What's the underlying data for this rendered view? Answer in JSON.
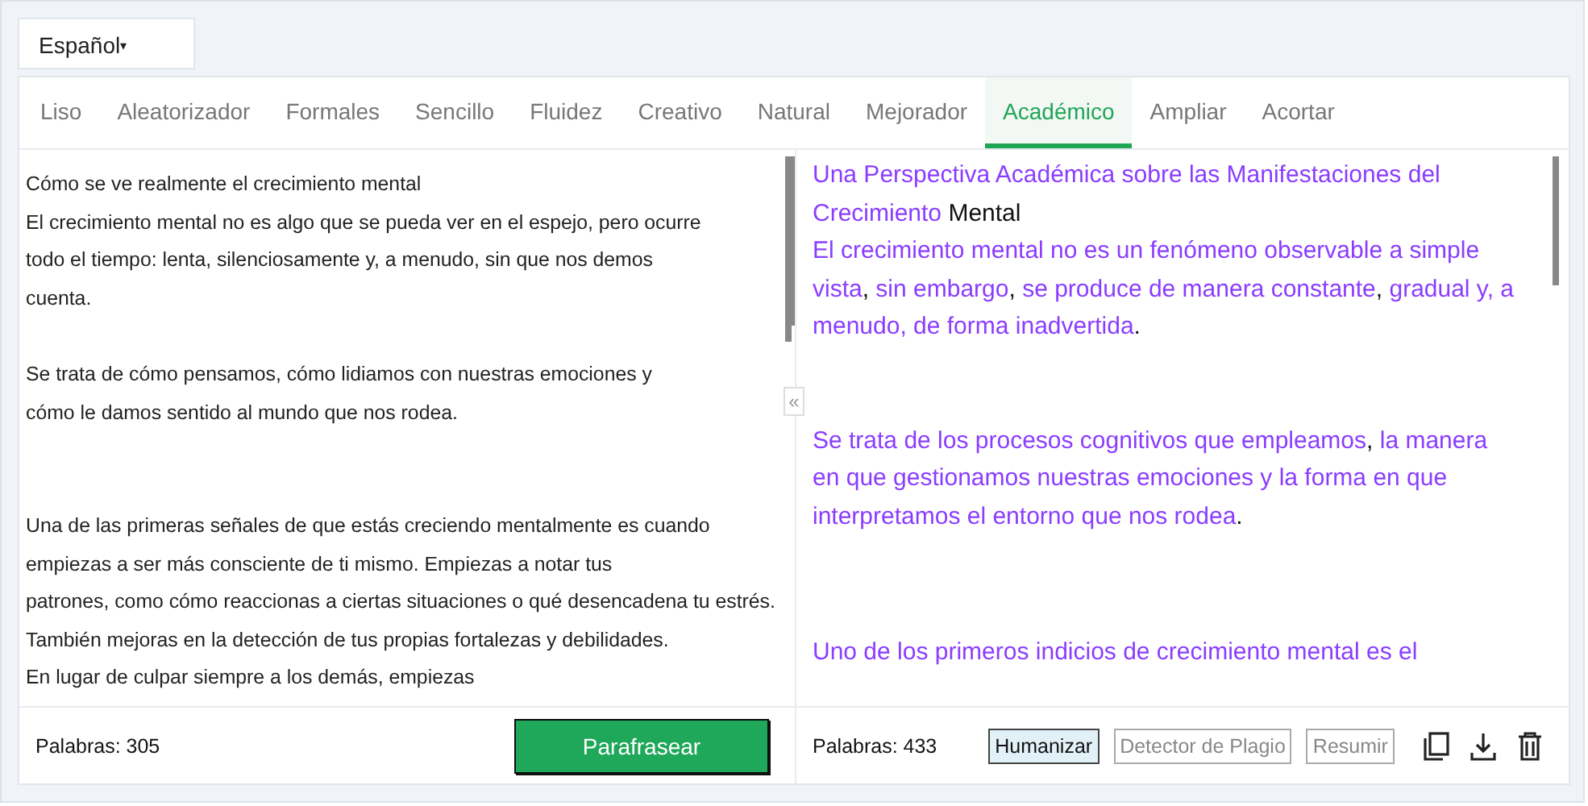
{
  "language_selector": {
    "value": "Español",
    "caret": "▾"
  },
  "tabs": [
    {
      "label": "Liso",
      "selected": false
    },
    {
      "label": "Aleatorizador",
      "selected": false
    },
    {
      "label": "Formales",
      "selected": false
    },
    {
      "label": "Sencillo",
      "selected": false
    },
    {
      "label": "Fluidez",
      "selected": false
    },
    {
      "label": "Creativo",
      "selected": false
    },
    {
      "label": "Natural",
      "selected": false
    },
    {
      "label": "Mejorador",
      "selected": false
    },
    {
      "label": "Académico",
      "selected": true
    },
    {
      "label": "Ampliar",
      "selected": false
    },
    {
      "label": "Acortar",
      "selected": false
    }
  ],
  "input": {
    "paragraphs": [
      [
        "Cómo se ve realmente el crecimiento mental",
        "El crecimiento mental no es algo que se pueda ver en el espejo, pero ocurre",
        "todo el tiempo: lenta, silenciosamente y, a menudo, sin que nos demos",
        "cuenta."
      ],
      [
        "Se trata de cómo pensamos, cómo lidiamos con nuestras emociones y",
        "cómo le damos sentido al mundo que nos rodea."
      ],
      [
        "Una de las primeras señales de que estás creciendo mentalmente es cuando",
        "empiezas a ser más consciente de ti mismo. Empiezas a notar tus",
        "patrones, como cómo reaccionas a ciertas situaciones o qué desencadena tu estrés.",
        "También mejoras en la detección de tus propias fortalezas y debilidades.",
        "En lugar de culpar siempre a los demás, empiezas"
      ]
    ],
    "word_count": "Palabras: 305",
    "action_button": "Parafrasear"
  },
  "collapse_button": "«",
  "output": {
    "paragraphs": [
      [
        {
          "text": "Una Perspectiva Académica sobre las Manifestaciones del Crecimiento",
          "changed": true
        },
        {
          "text": " Mental",
          "changed": false
        }
      ],
      [
        {
          "text": "El crecimiento mental no es un fenómeno observable a simple vista",
          "changed": true
        },
        {
          "text": ",",
          "changed": false
        },
        {
          "text": " sin embargo",
          "changed": true
        },
        {
          "text": ",",
          "changed": false
        },
        {
          "text": " se produce de manera constante",
          "changed": true
        },
        {
          "text": ",",
          "changed": false
        },
        {
          "text": " gradual y, a menudo, de forma inadvertida",
          "changed": true
        },
        {
          "text": ".",
          "changed": false
        }
      ],
      [
        {
          "text": "Se trata de los procesos cognitivos que empleamos",
          "changed": true
        },
        {
          "text": ",",
          "changed": false
        },
        {
          "text": " la manera en que gestionamos nuestras emociones y la forma en que interpretamos el entorno que nos rodea",
          "changed": true
        },
        {
          "text": ".",
          "changed": false
        }
      ],
      [
        {
          "text": "Uno de los primeros indicios de crecimiento mental es el",
          "changed": true
        }
      ]
    ],
    "word_count": "Palabras: 433",
    "tools": [
      {
        "label": "Humanizar",
        "selected": true
      },
      {
        "label": "Detector de Plagio",
        "selected": false
      },
      {
        "label": "Resumir",
        "selected": false
      }
    ]
  }
}
